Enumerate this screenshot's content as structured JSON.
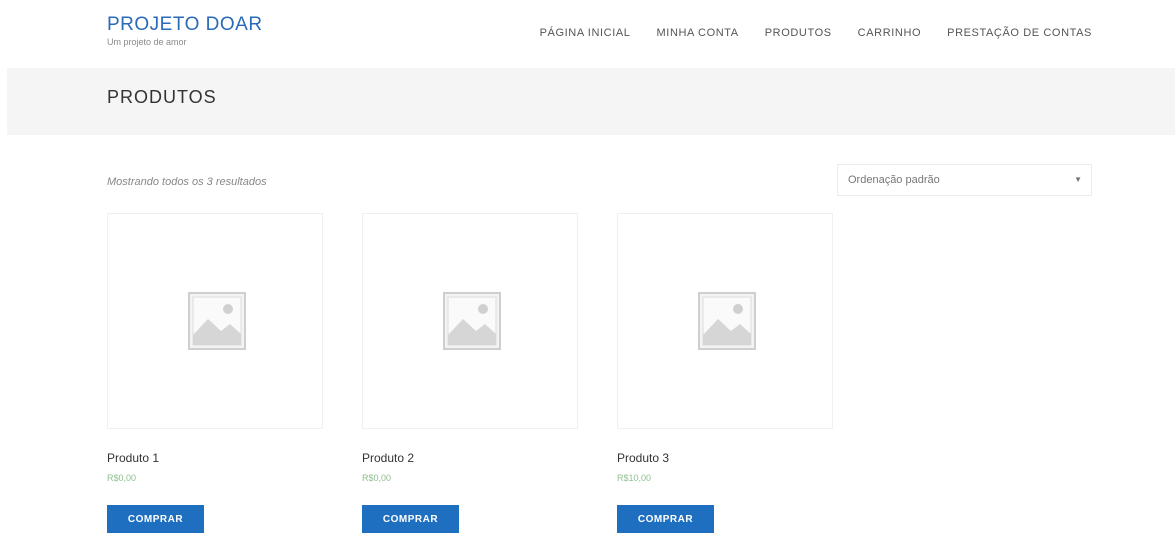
{
  "site": {
    "title": "PROJETO DOAR",
    "tagline": "Um projeto de amor"
  },
  "nav": {
    "items": [
      {
        "label": "PÁGINA INICIAL"
      },
      {
        "label": "MINHA CONTA"
      },
      {
        "label": "PRODUTOS"
      },
      {
        "label": "CARRINHO"
      },
      {
        "label": "PRESTAÇÃO DE CONTAS"
      }
    ]
  },
  "page": {
    "title": "PRODUTOS"
  },
  "shop": {
    "result_count": "Mostrando todos os 3 resultados",
    "sort": {
      "selected": "Ordenação padrão"
    },
    "products": [
      {
        "name": "Produto 1",
        "price": "R$0,00",
        "button": "COMPRAR"
      },
      {
        "name": "Produto 2",
        "price": "R$0,00",
        "button": "COMPRAR"
      },
      {
        "name": "Produto 3",
        "price": "R$10,00",
        "button": "COMPRAR"
      }
    ]
  },
  "icons": {
    "placeholder": "image-placeholder-icon",
    "sort_arrow": "caret-down-icon"
  },
  "colors": {
    "brand": "#2a6ab8",
    "button": "#1e6fc0",
    "price": "#8fbf8f",
    "band": "#f5f5f5"
  }
}
